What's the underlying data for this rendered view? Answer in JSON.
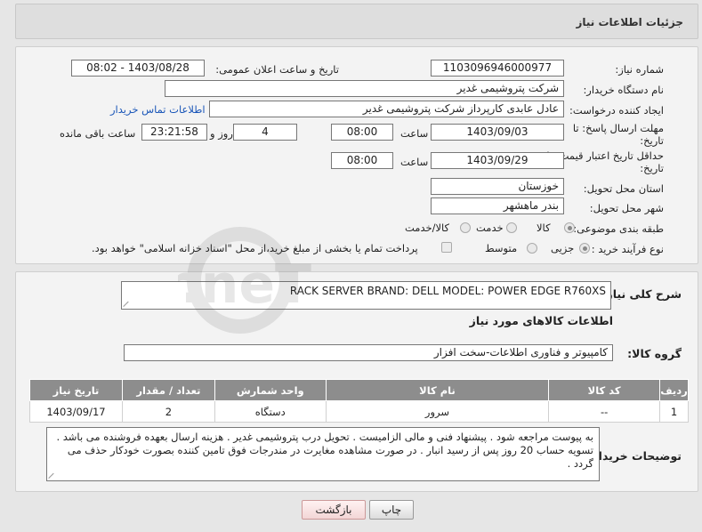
{
  "header": {
    "title": "جزئیات اطلاعات نیاز"
  },
  "form": {
    "need_number": {
      "label": "شماره نیاز:",
      "value": "1103096946000977"
    },
    "announce": {
      "label": "تاریخ و ساعت اعلان عمومی:",
      "value": "1403/08/28 - 08:02"
    },
    "buyer_org": {
      "label": "نام دستگاه خریدار:",
      "value": "شرکت پتروشیمی غدیر"
    },
    "creator": {
      "label": "ایجاد کننده درخواست:",
      "value": "عادل عابدی کارپرداز شرکت پتروشیمی غدیر",
      "contact_link": "اطلاعات تماس خریدار"
    },
    "reply_deadline": {
      "label_line1": "مهلت ارسال پاسخ: تا",
      "label_line2": "تاریخ:",
      "date": "1403/09/03",
      "time_label": "ساعت",
      "time": "08:00",
      "days": "4",
      "days_label": "روز و",
      "remaining": "23:21:58",
      "remaining_label": "ساعت باقی مانده"
    },
    "price_validity": {
      "label_line1": "حداقل تاریخ اعتبار قیمت: تا",
      "label_line2": "تاریخ:",
      "date": "1403/09/29",
      "time_label": "ساعت",
      "time": "08:00"
    },
    "province": {
      "label": "استان محل تحویل:",
      "value": "خوزستان"
    },
    "city": {
      "label": "شهر محل تحویل:",
      "value": "بندر ماهشهر"
    },
    "category": {
      "label": "طبقه بندی موضوعی:",
      "options": [
        "کالا",
        "خدمت",
        "کالا/خدمت"
      ],
      "selected": "کالا"
    },
    "process": {
      "label": "نوع فرآیند خرید :",
      "options": [
        "جزیی",
        "متوسط"
      ],
      "selected": "جزیی",
      "payment_note": "پرداخت تمام یا بخشی از مبلغ خرید،از محل \"اسناد خزانه اسلامی\" خواهد بود."
    }
  },
  "details": {
    "summary_label": "شرح کلی نیاز:",
    "summary_value": "RACK SERVER  BRAND: DELL  MODEL: POWER EDGE R760XS",
    "goods_info_title": "اطلاعات کالاهای مورد نیاز",
    "group_label": "گروه کالا:",
    "group_value": "کامپیوتر و فناوری اطلاعات-سخت افزار",
    "table": {
      "headers": [
        "ردیف",
        "کد کالا",
        "نام کالا",
        "واحد شمارش",
        "تعداد / مقدار",
        "تاریخ نیاز"
      ],
      "rows": [
        [
          "1",
          "--",
          "سرور",
          "دستگاه",
          "2",
          "1403/09/17"
        ]
      ]
    },
    "buyer_notes_label": "توضیحات خریدار:",
    "buyer_notes": "به پیوست مراجعه شود . پیشنهاد فنی و مالی الزامیست . تحویل درب پتروشیمی غدیر . هزینه ارسال بعهده فروشنده می باشد . تسویه حساب 20 روز پس از رسید انبار .  در صورت مشاهده مغایرت در مندرجات فوق تامین کننده بصورت خودکار حذف می گردد ."
  },
  "buttons": {
    "print": "چاپ",
    "back": "بازگشت"
  },
  "watermark": {
    "text": "AriaTender.neT"
  }
}
